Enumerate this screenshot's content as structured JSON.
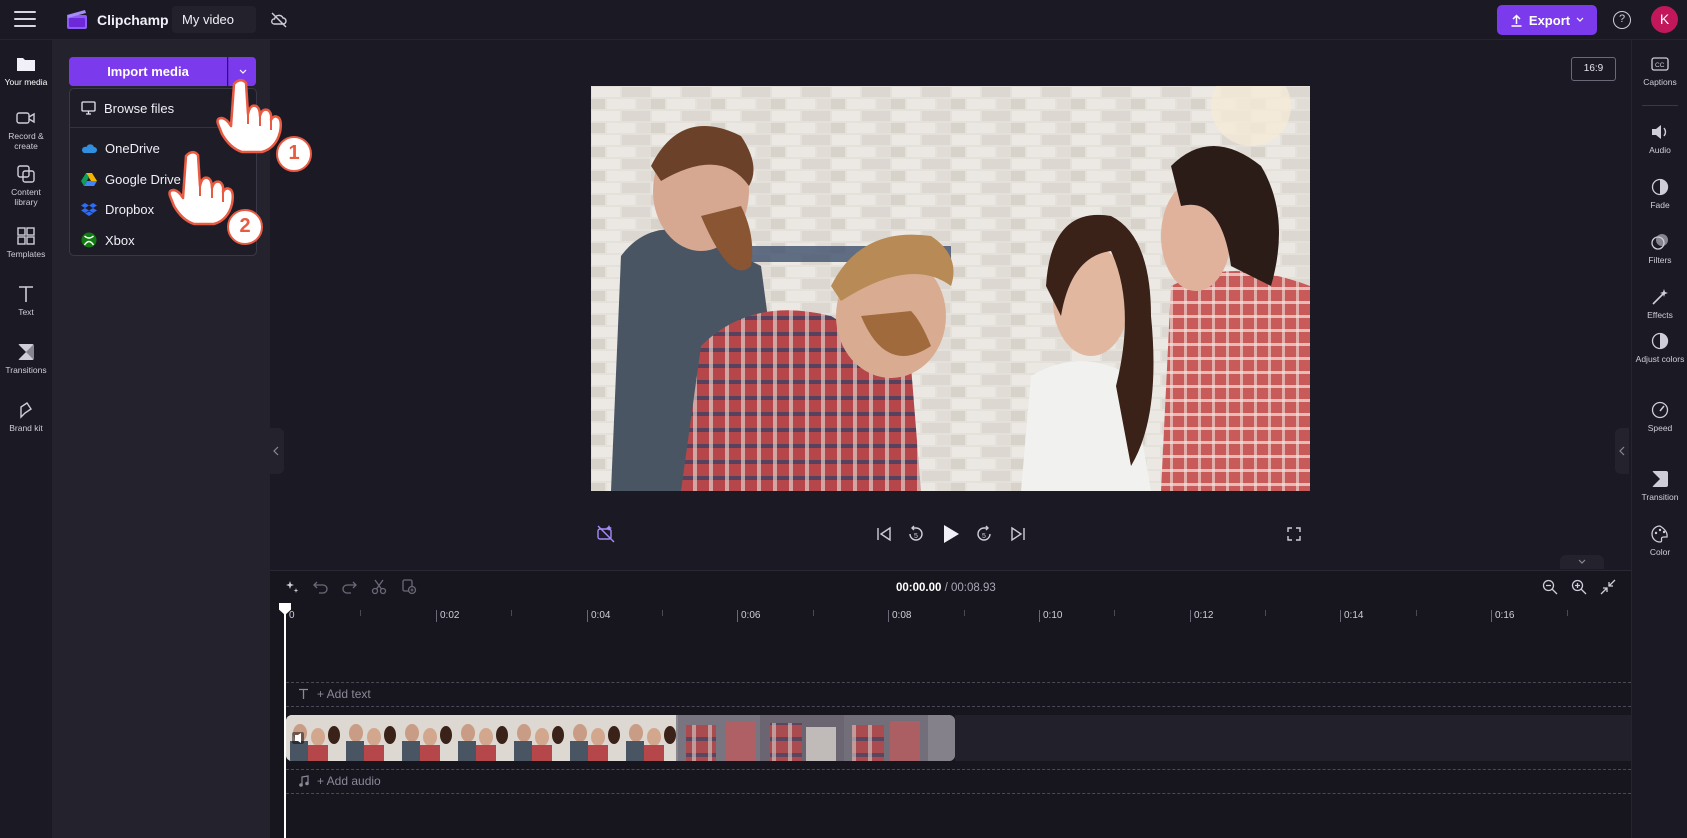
{
  "header": {
    "app_name": "Clipchamp",
    "project_name": "My video",
    "export_label": "Export",
    "help_label": "?",
    "avatar_initial": "K"
  },
  "left_rail": {
    "items": [
      {
        "label": "Your media",
        "icon": "folder-icon"
      },
      {
        "label": "Record & create",
        "icon": "camera-icon"
      },
      {
        "label": "Content library",
        "icon": "library-icon"
      },
      {
        "label": "Templates",
        "icon": "templates-icon"
      },
      {
        "label": "Text",
        "icon": "text-icon"
      },
      {
        "label": "Transitions",
        "icon": "transitions-icon"
      },
      {
        "label": "Brand kit",
        "icon": "brand-kit-icon"
      }
    ]
  },
  "media_panel": {
    "import_label": "Import media",
    "dropdown": [
      {
        "label": "Browse files",
        "icon": "monitor-icon"
      },
      {
        "label": "OneDrive",
        "icon": "onedrive-icon"
      },
      {
        "label": "Google Drive",
        "icon": "google-drive-icon"
      },
      {
        "label": "Dropbox",
        "icon": "dropbox-icon"
      },
      {
        "label": "Xbox",
        "icon": "xbox-icon"
      }
    ]
  },
  "preview": {
    "aspect_ratio": "16:9"
  },
  "right_rail": {
    "items": [
      {
        "label": "Captions",
        "icon": "captions-icon"
      },
      {
        "label": "Audio",
        "icon": "speaker-icon"
      },
      {
        "label": "Fade",
        "icon": "fade-icon"
      },
      {
        "label": "Filters",
        "icon": "filters-icon"
      },
      {
        "label": "Effects",
        "icon": "magic-wand-icon"
      },
      {
        "label": "Adjust colors",
        "icon": "contrast-icon"
      },
      {
        "label": "Speed",
        "icon": "speedometer-icon"
      },
      {
        "label": "Transition",
        "icon": "transition-icon"
      },
      {
        "label": "Color",
        "icon": "palette-icon"
      }
    ]
  },
  "timeline": {
    "current_time": "00:00.00",
    "duration": "/ 00:08.93",
    "ruler_labels": [
      "0",
      "0:02",
      "0:04",
      "0:06",
      "0:08",
      "0:10",
      "0:12",
      "0:14",
      "0:16"
    ],
    "add_text_label": "+ Add text",
    "add_audio_label": "+ Add audio"
  },
  "annotations": {
    "step1": "1",
    "step2": "2"
  },
  "colors": {
    "accent": "#7c3aed",
    "avatar": "#c2185b",
    "badge": "#e85a42"
  }
}
